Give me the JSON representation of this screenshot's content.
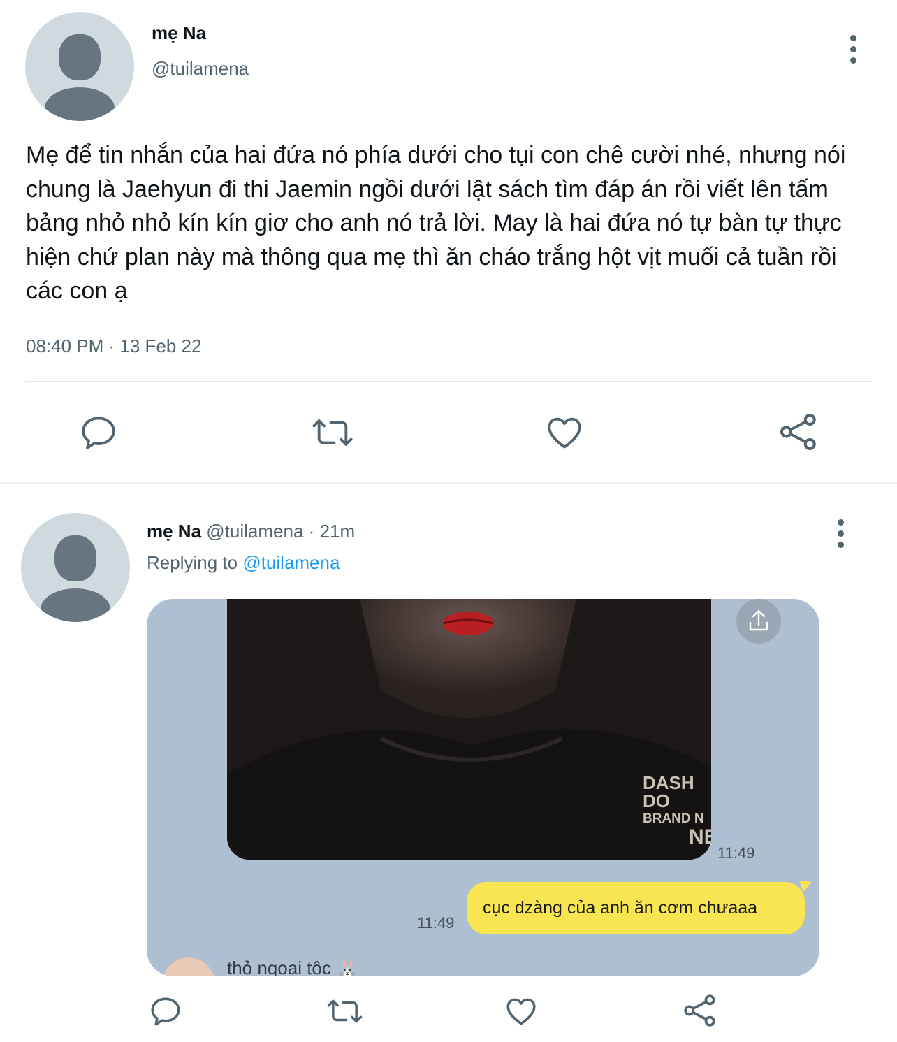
{
  "main_tweet": {
    "author_name": "mẹ Na",
    "author_handle": "@tuilamena",
    "text": "Mẹ để tin nhắn của hai đứa nó phía dưới cho tụi con chê cười nhé, nhưng nói chung là Jaehyun đi thi Jaemin ngồi dưới lật sách tìm đáp án rồi viết lên tấm bảng nhỏ nhỏ kín kín giơ cho anh nó trả lời. May là hai đứa nó tự bàn tự thực hiện chứ plan này mà thông qua mẹ thì ăn cháo trắng hột vịt muối cả tuần rồi các con ạ",
    "timestamp": "08:40 PM · 13 Feb 22",
    "actions": [
      "reply-icon",
      "retweet-icon",
      "like-icon",
      "share-icon"
    ]
  },
  "reply_tweet": {
    "author_name": "mẹ Na",
    "author_handle": "@tuilamena",
    "separator": "·",
    "age": "21m",
    "replying_prefix": "Replying to",
    "replying_handle": "@tuilamena",
    "media": {
      "photo_watermark_line1": "DASH DO",
      "photo_watermark_line2": "BRAND N",
      "photo_watermark_line3": "NE",
      "photo_time": "11:49",
      "bubble_time": "11:49",
      "bubble_text": "cục dzàng của anh ăn cơm chưaaa",
      "next_sender": "thỏ ngoại tộc 🐰"
    },
    "actions": [
      "reply-icon",
      "retweet-icon",
      "like-icon",
      "share-icon"
    ]
  },
  "colors": {
    "text": "#0f1419",
    "secondary": "#536471",
    "link": "#1d9bf0",
    "chat_bg": "#aebfd1",
    "bubble": "#f9e552"
  }
}
